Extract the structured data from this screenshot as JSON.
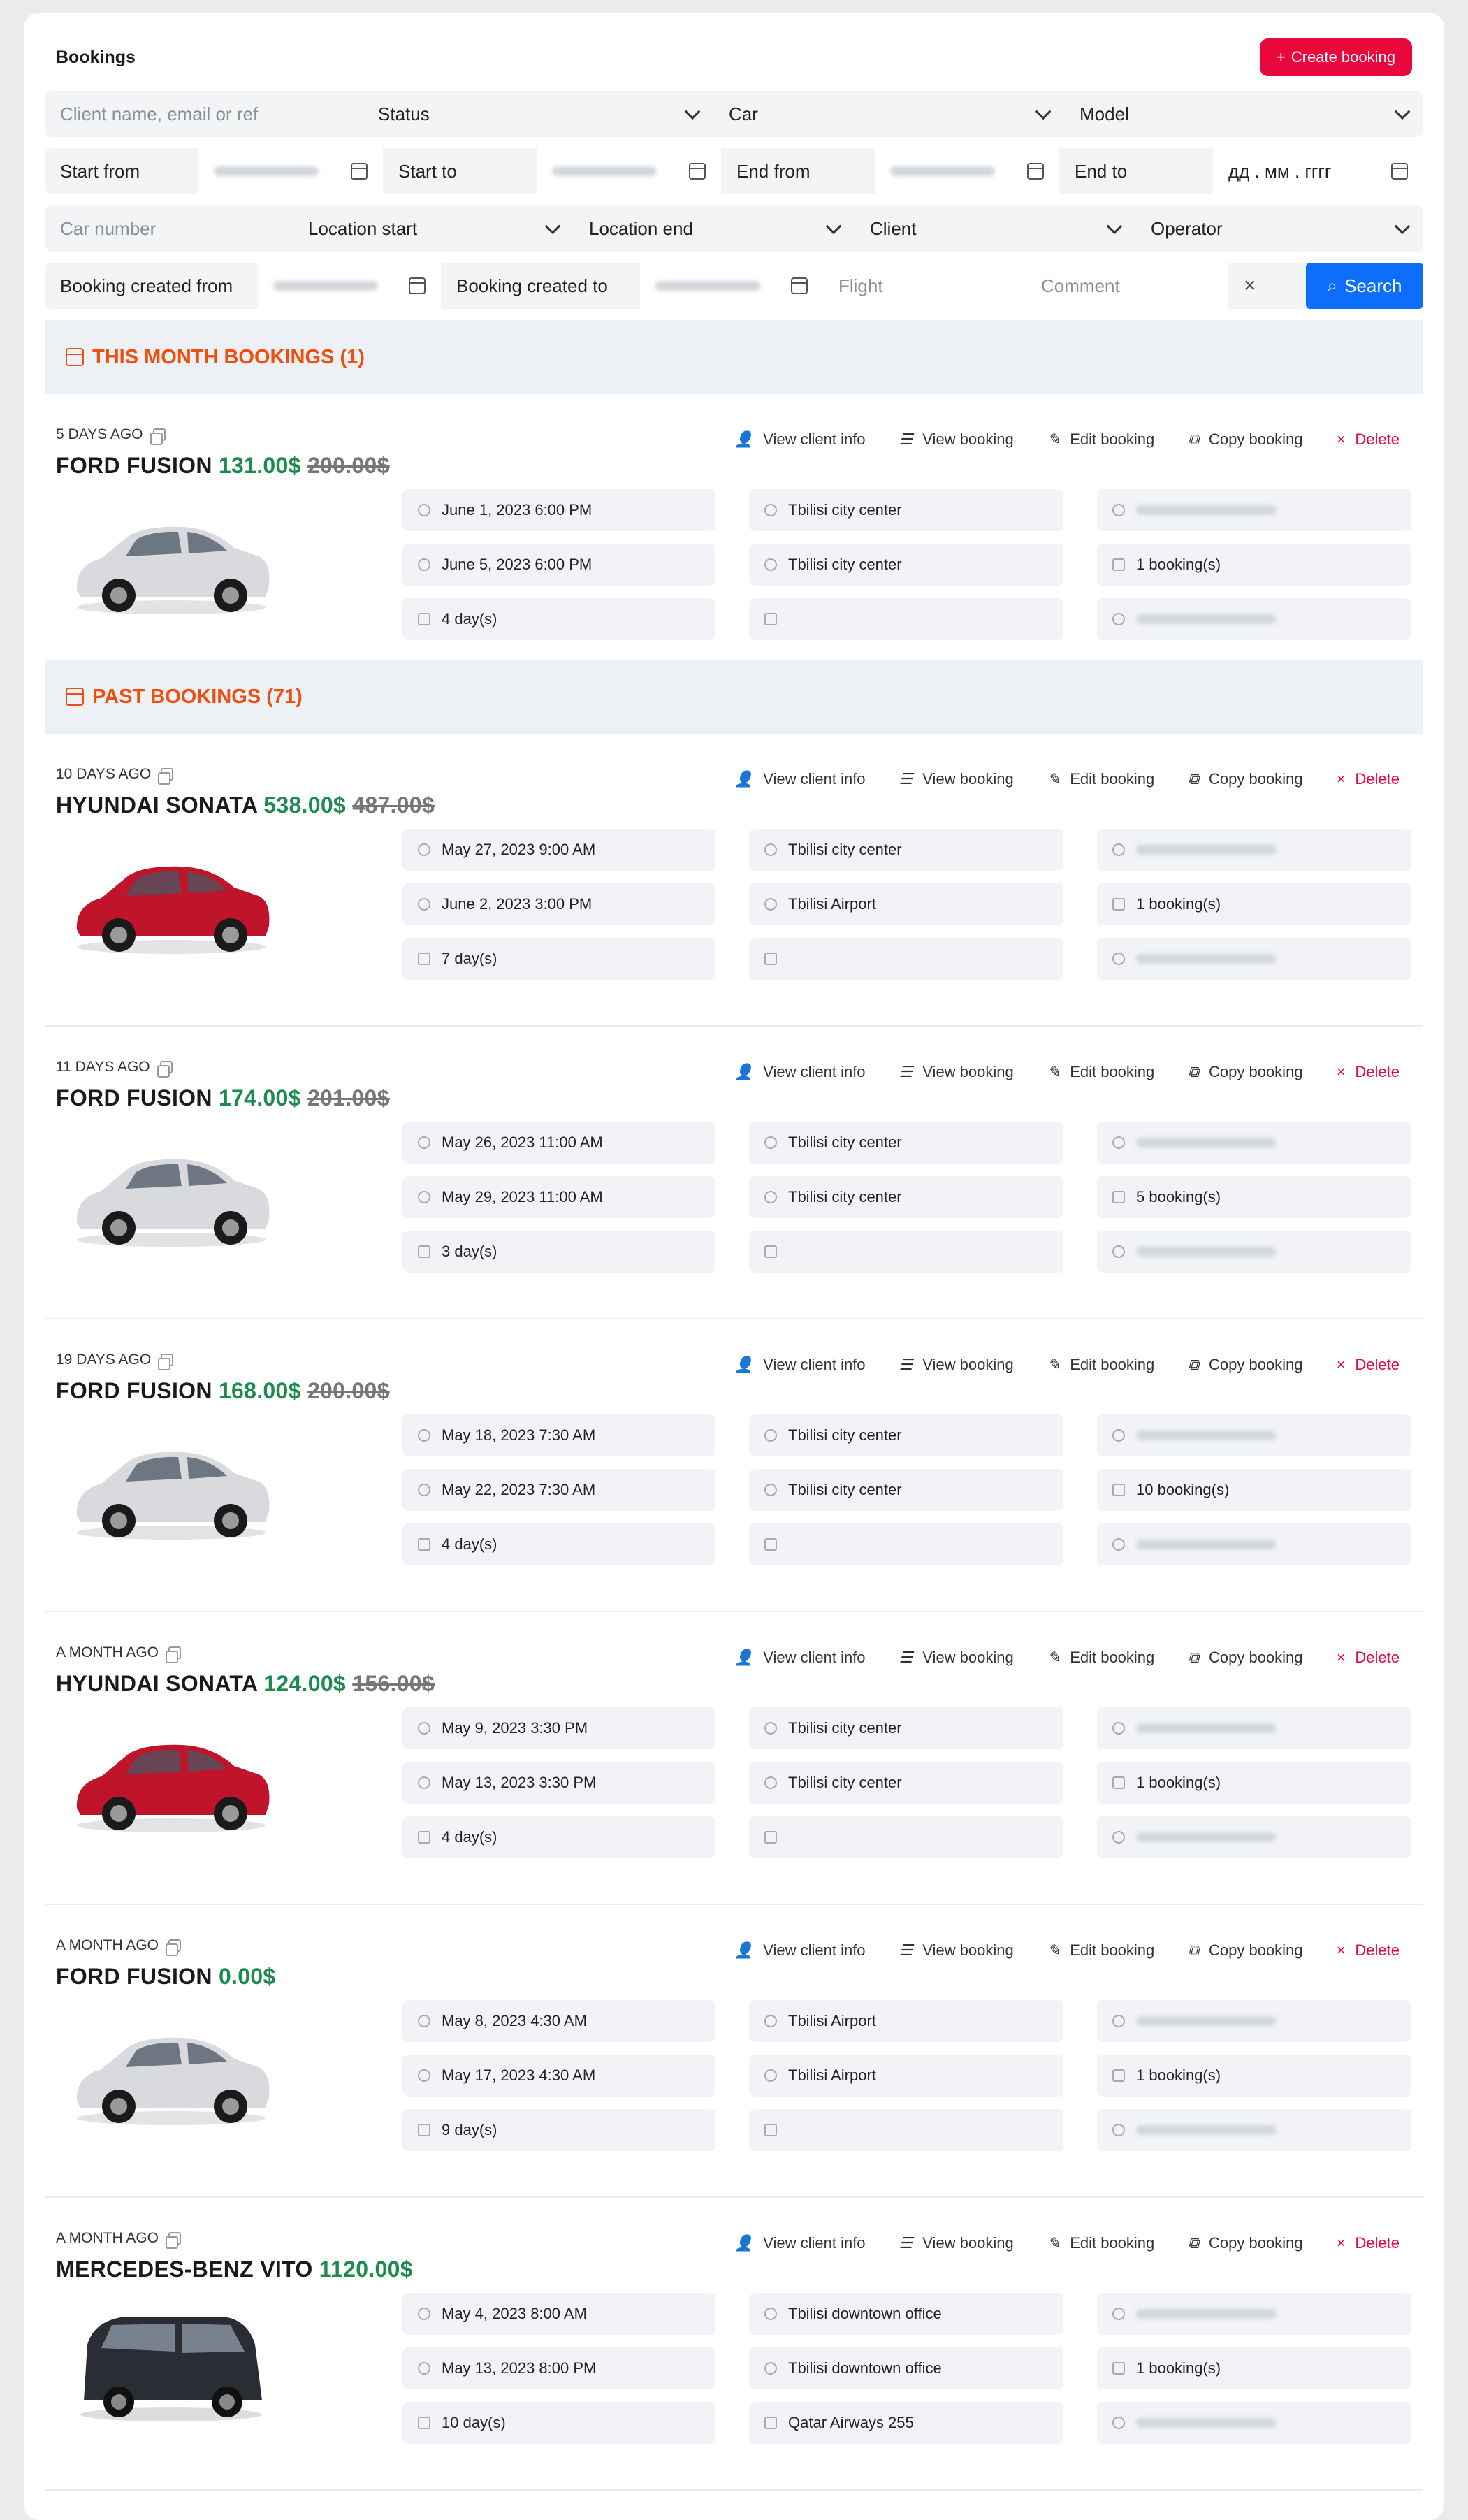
{
  "page": {
    "title": "Bookings",
    "create_label": "Create booking"
  },
  "filters": {
    "client_placeholder": "Client name, email or ref",
    "status": "Status",
    "car": "Car",
    "model": "Model",
    "start_from": "Start from",
    "start_to": "Start to",
    "end_from": "End from",
    "end_to": "End to",
    "date_placeholder": "дд . мм . гггг",
    "car_number_placeholder": "Car number",
    "location_start": "Location start",
    "location_end": "Location end",
    "client": "Client",
    "operator": "Operator",
    "created_from": "Booking created from",
    "created_to": "Booking created to",
    "flight_placeholder": "Flight",
    "comment_placeholder": "Comment",
    "search_label": "Search"
  },
  "actions": {
    "view_client": "View client info",
    "view_booking": "View booking",
    "edit": "Edit booking",
    "copy": "Copy booking",
    "delete": "Delete"
  },
  "sections": {
    "this_month": "THIS MONTH BOOKINGS (1)",
    "past": "PAST BOOKINGS (71)"
  },
  "bookings": [
    {
      "ago": "5 DAYS AGO",
      "car": "FORD FUSION",
      "price": "131.00$",
      "old_price": "200.00$",
      "start": "June 1, 2023 6:00 PM",
      "end": "June 5, 2023 6:00 PM",
      "days": "4 day(s)",
      "loc_start": "Tbilisi city center",
      "loc_end": "Tbilisi city center",
      "flight": "",
      "count": "1 booking(s)",
      "color": "#d8dadd"
    },
    {
      "ago": "10 DAYS AGO",
      "car": "HYUNDAI SONATA",
      "price": "538.00$",
      "old_price": "487.00$",
      "start": "May 27, 2023 9:00 AM",
      "end": "June 2, 2023 3:00 PM",
      "days": "7 day(s)",
      "loc_start": "Tbilisi city center",
      "loc_end": "Tbilisi Airport",
      "flight": "",
      "count": "1 booking(s)",
      "color": "#c0142b"
    },
    {
      "ago": "11 DAYS AGO",
      "car": "FORD FUSION",
      "price": "174.00$",
      "old_price": "201.00$",
      "start": "May 26, 2023 11:00 AM",
      "end": "May 29, 2023 11:00 AM",
      "days": "3 day(s)",
      "loc_start": "Tbilisi city center",
      "loc_end": "Tbilisi city center",
      "flight": "",
      "count": "5 booking(s)",
      "color": "#d8dadd"
    },
    {
      "ago": "19 DAYS AGO",
      "car": "FORD FUSION",
      "price": "168.00$",
      "old_price": "200.00$",
      "start": "May 18, 2023 7:30 AM",
      "end": "May 22, 2023 7:30 AM",
      "days": "4 day(s)",
      "loc_start": "Tbilisi city center",
      "loc_end": "Tbilisi city center",
      "flight": "",
      "count": "10 booking(s)",
      "color": "#d8dadd"
    },
    {
      "ago": "A MONTH AGO",
      "car": "HYUNDAI SONATA",
      "price": "124.00$",
      "old_price": "156.00$",
      "start": "May 9, 2023 3:30 PM",
      "end": "May 13, 2023 3:30 PM",
      "days": "4 day(s)",
      "loc_start": "Tbilisi city center",
      "loc_end": "Tbilisi city center",
      "flight": "",
      "count": "1 booking(s)",
      "color": "#c0142b"
    },
    {
      "ago": "A MONTH AGO",
      "car": "FORD FUSION",
      "price": "0.00$",
      "old_price": "",
      "start": "May 8, 2023 4:30 AM",
      "end": "May 17, 2023 4:30 AM",
      "days": "9 day(s)",
      "loc_start": "Tbilisi Airport",
      "loc_end": "Tbilisi Airport",
      "flight": "",
      "count": "1 booking(s)",
      "color": "#d8dadd"
    },
    {
      "ago": "A MONTH AGO",
      "car": "MERCEDES-BENZ VITO",
      "price": "1120.00$",
      "old_price": "",
      "start": "May 4, 2023 8:00 AM",
      "end": "May 13, 2023 8:00 PM",
      "days": "10 day(s)",
      "loc_start": "Tbilisi downtown office",
      "loc_end": "Tbilisi downtown office",
      "flight": "Qatar Airways 255",
      "count": "1 booking(s)",
      "color": "#2a2d33"
    }
  ]
}
